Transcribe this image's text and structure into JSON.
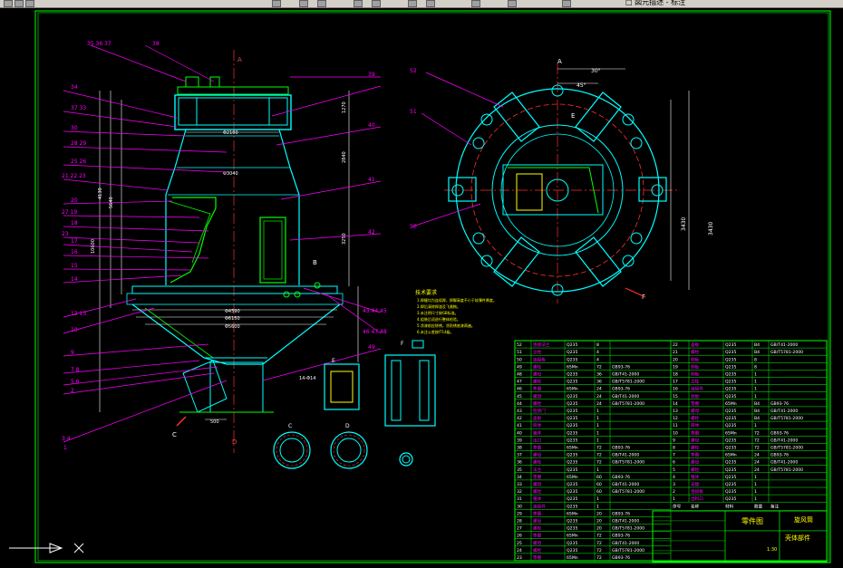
{
  "app": {
    "toolbar_text": "□ 図元描述 - 标注"
  },
  "main_view": {
    "labels_left": [
      "34",
      "37 33",
      "30",
      "28 29",
      "25 26",
      "21 22 23",
      "20",
      "27 19",
      "18",
      "23",
      "17",
      "16",
      "15",
      "14",
      "12 13",
      "10",
      "9",
      "7 8",
      "5 6",
      "2",
      "3 4",
      "1"
    ],
    "labels_top": [
      "35 36 37",
      "38"
    ],
    "labels_right": [
      "39",
      "40",
      "41",
      "42",
      "43 44 45",
      "46 47 48",
      "49"
    ],
    "axis_marks": {
      "a_top": "A",
      "b": "B",
      "c": "C",
      "d": "D"
    }
  },
  "top_view": {
    "labels": [
      "52",
      "51",
      "50",
      "A",
      "E",
      "F"
    ],
    "angle_labels": [
      "30°",
      "45°"
    ]
  },
  "detail_views": {
    "c_label": "C",
    "d_label": "D",
    "e_label": "E",
    "f_label": "F",
    "section": "14-Φ14"
  },
  "notes": {
    "title": "技术要求",
    "lines": [
      "1.焊缝均为连续焊，焊脚高度不小于较薄件厚度。",
      "2.焊后清除焊渣及飞溅物。",
      "3.未注明尺寸按GB标准。",
      "4.组装后须进行整体检验。",
      "5.涂漆前应除锈，涂防锈底漆两遍。",
      "6.未注公差按IT14级。"
    ]
  },
  "bom": {
    "left_rows": [
      [
        "52",
        "连接法兰",
        "Q235",
        "8",
        ""
      ],
      [
        "51",
        "立柱",
        "Q235",
        "4",
        ""
      ],
      [
        "50",
        "连接板",
        "Q235",
        "4",
        ""
      ],
      [
        "49",
        "螺栓",
        "65Mn",
        "72",
        "GB93-76"
      ],
      [
        "48",
        "螺母",
        "Q235",
        "36",
        "GB/T41-2000"
      ],
      [
        "47",
        "螺栓",
        "Q235",
        "36",
        "GB/T5781-2000"
      ],
      [
        "46",
        "垫圈",
        "65Mn",
        "24",
        "GB93-76"
      ],
      [
        "45",
        "螺母",
        "Q235",
        "24",
        "GB/T41-2000"
      ],
      [
        "44",
        "螺栓",
        "Q235",
        "24",
        "GB/T5781-2000"
      ],
      [
        "43",
        "检修门",
        "Q235",
        "1",
        ""
      ],
      [
        "42",
        "盖板",
        "Q235",
        "1",
        ""
      ],
      [
        "41",
        "筒体",
        "Q235",
        "1",
        ""
      ],
      [
        "40",
        "锥体",
        "Q235",
        "1",
        ""
      ],
      [
        "39",
        "出口",
        "Q235",
        "1",
        ""
      ],
      [
        "38",
        "垫圈",
        "65Mn",
        "72",
        "GB93-76"
      ],
      [
        "37",
        "螺母",
        "Q235",
        "72",
        "GB/T41-2000"
      ],
      [
        "36",
        "螺栓",
        "Q235",
        "72",
        "GB/T5781-2000"
      ],
      [
        "35",
        "法兰",
        "Q235",
        "1",
        ""
      ],
      [
        "34",
        "垫圈",
        "65Mn",
        "60",
        "GB93-76"
      ],
      [
        "33",
        "螺母",
        "Q235",
        "60",
        "GB/T41-2000"
      ],
      [
        "32",
        "螺栓",
        "Q235",
        "60",
        "GB/T5781-2000"
      ],
      [
        "31",
        "锥体",
        "Q235",
        "1",
        ""
      ],
      [
        "30",
        "连接件",
        "Q235",
        "1",
        ""
      ],
      [
        "29",
        "垫圈",
        "65Mn",
        "20",
        "GB93-76"
      ],
      [
        "28",
        "螺母",
        "Q235",
        "20",
        "GB/T41-2000"
      ],
      [
        "27",
        "螺栓",
        "Q235",
        "20",
        "GB/T5781-2000"
      ],
      [
        "26",
        "垫圈",
        "65Mn",
        "72",
        "GB93-76"
      ],
      [
        "25",
        "螺母",
        "Q235",
        "72",
        "GB/T41-2000"
      ],
      [
        "24",
        "螺栓",
        "Q235",
        "72",
        "GB/T5781-2000"
      ],
      [
        "23",
        "垫圈",
        "65Mn",
        "72",
        "GB93-76"
      ]
    ],
    "right_rows": [
      [
        "22",
        "盖板",
        "Q235",
        "B4",
        "GB/T41-2000"
      ],
      [
        "21",
        "螺栓",
        "Q235",
        "B4",
        "GB/T5781-2000"
      ],
      [
        "20",
        "侧板",
        "Q235",
        "8",
        ""
      ],
      [
        "19",
        "侧板",
        "Q235",
        "8",
        ""
      ],
      [
        "18",
        "侧板",
        "Q235",
        "1",
        ""
      ],
      [
        "17",
        "立柱",
        "Q235",
        "1",
        ""
      ],
      [
        "16",
        "连接件",
        "Q235",
        "1",
        ""
      ],
      [
        "15",
        "封板",
        "Q235",
        "1",
        ""
      ],
      [
        "14",
        "垫圈",
        "65Mn",
        "B4",
        "GB93-76"
      ],
      [
        "13",
        "螺母",
        "Q235",
        "B4",
        "GB/T41-2000"
      ],
      [
        "12",
        "螺栓",
        "Q235",
        "B4",
        "GB/T5781-2000"
      ],
      [
        "11",
        "筒体",
        "Q235",
        "1",
        ""
      ],
      [
        "10",
        "垫圈",
        "65Mn",
        "72",
        "GB93-76"
      ],
      [
        "9",
        "螺母",
        "Q235",
        "72",
        "GB/T41-2000"
      ],
      [
        "8",
        "螺栓",
        "Q235",
        "72",
        "GB/T5781-2000"
      ],
      [
        "7",
        "垫圈",
        "65Mn",
        "24",
        "GB93-76"
      ],
      [
        "6",
        "螺母",
        "Q235",
        "24",
        "GB/T41-2000"
      ],
      [
        "5",
        "螺栓",
        "Q235",
        "24",
        "GB/T5781-2000"
      ],
      [
        "4",
        "锥体",
        "Q235",
        "1",
        ""
      ],
      [
        "3",
        "支腿",
        "Q235",
        "1",
        ""
      ],
      [
        "2",
        "连接板",
        "Q235",
        "1",
        ""
      ],
      [
        "1",
        "出料口",
        "Q235",
        "1",
        ""
      ]
    ],
    "header": [
      "序号",
      "名称",
      "材料",
      "数量",
      "备注"
    ],
    "title_block": {
      "drawing_name": "旋风筒",
      "part_name": "零件图",
      "subtitle": "壳体部件",
      "scale": "1:30"
    }
  }
}
